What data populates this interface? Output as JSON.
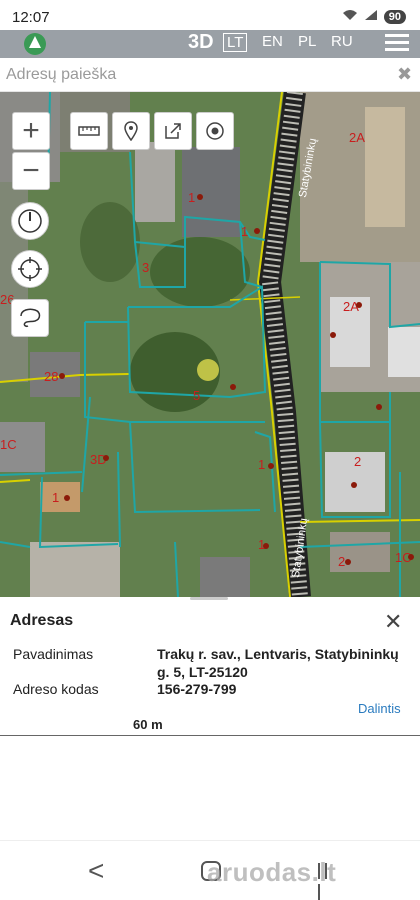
{
  "status_bar": {
    "time": "12:07",
    "battery": "90"
  },
  "topbar": {
    "mode": "3D",
    "languages": [
      "LT",
      "EN",
      "PL",
      "RU"
    ],
    "active_language": "LT"
  },
  "search": {
    "placeholder": "Adresų paieška"
  },
  "map": {
    "street_label_top": "Statybininkų",
    "street_label_bottom": "Statybininkų",
    "parcel_labels": [
      "2A",
      "1",
      "1",
      "3",
      "26",
      "2A",
      "28",
      "5",
      "1C",
      "3D",
      "1",
      "2",
      "1",
      "1",
      "1C",
      "2"
    ],
    "highlight_color": "#1a9a9a",
    "parcel_line_color": "#1fa6a6",
    "yellow_line_color": "#d8d000"
  },
  "address_panel": {
    "title": "Adresas",
    "fields": [
      {
        "label": "Pavadinimas",
        "value": "Trakų r. sav., Lentvaris, Statybininkų g. 5, LT-25120"
      },
      {
        "label": "Adreso kodas",
        "value": "156-279-799"
      }
    ],
    "share_label": "Dalintis",
    "scale": "60 m"
  },
  "watermark": "aruodas.lt"
}
